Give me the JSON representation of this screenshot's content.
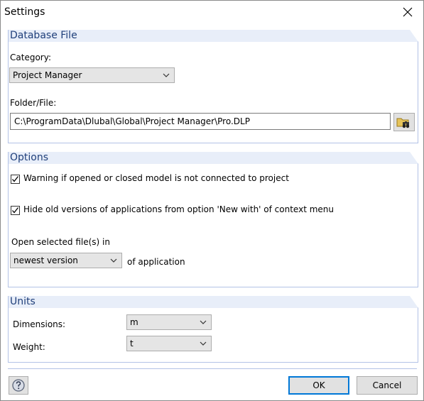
{
  "window": {
    "title": "Settings"
  },
  "database": {
    "header": "Database File",
    "category_label": "Category:",
    "category_value": "Project Manager",
    "folder_label": "Folder/File:",
    "folder_value": "C:\\ProgramData\\Dlubal\\Global\\Project Manager\\Pro.DLP"
  },
  "options": {
    "header": "Options",
    "warning_label": "Warning if opened or closed model is not connected to project",
    "warning_checked": true,
    "hide_label": "Hide old versions of applications from option 'New with' of context menu",
    "hide_checked": true,
    "open_label": "Open selected file(s) in",
    "version_value": "newest version",
    "of_app_label": "of application"
  },
  "units": {
    "header": "Units",
    "dimensions_label": "Dimensions:",
    "dimensions_value": "m",
    "weight_label": "Weight:",
    "weight_value": "t"
  },
  "footer": {
    "ok_label": "OK",
    "cancel_label": "Cancel"
  },
  "colors": {
    "accent": "#0078d7",
    "section_header": "#e8eef9",
    "section_title": "#1f3f7a"
  },
  "icons": [
    "close-icon",
    "chevron-down-icon",
    "browse-folder-icon",
    "checkmark-icon",
    "help-icon"
  ]
}
